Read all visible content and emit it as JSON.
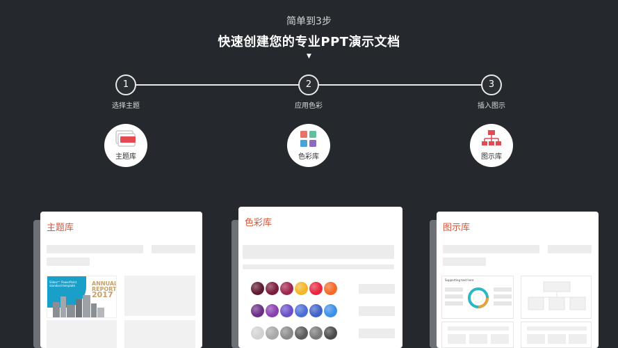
{
  "header": {
    "subtitle": "简单到3步",
    "title": "快速创建您的专业PPT演示文档",
    "arrow": "▼"
  },
  "steps": [
    {
      "number": "1",
      "label": "选择主题"
    },
    {
      "number": "2",
      "label": "应用色彩"
    },
    {
      "number": "3",
      "label": "插入图示"
    }
  ],
  "libraries": [
    {
      "label": "主题库",
      "icon": "slides-icon"
    },
    {
      "label": "色彩库",
      "icon": "color-palette-icon"
    },
    {
      "label": "图示库",
      "icon": "org-chart-icon"
    }
  ],
  "cards": {
    "theme": {
      "title": "主题库",
      "cover": {
        "line1": "Slidez™ PowerPoint",
        "line2": "standard template",
        "report": "ANNUAL REPORT",
        "year": "2017"
      }
    },
    "color": {
      "title": "色彩库"
    },
    "diagram": {
      "title": "图示库",
      "caption": "Supporting text here"
    }
  },
  "palette": {
    "rows": [
      [
        "#5e1a33",
        "#7a1c3d",
        "#a0254e",
        "#f3b62a",
        "#e8263f",
        "#f46a2a"
      ],
      [
        "#6a2e86",
        "#8a3fb0",
        "#6a4fc8",
        "#4a6ed6",
        "#3f62c6",
        "#3d8fe8"
      ],
      [
        "#d2d2d2",
        "#a8a8a8",
        "#8a8a8a",
        "#5c5c5c",
        "#7a7a7a",
        "#4a4a4a"
      ]
    ]
  },
  "colors": {
    "background": "#25282c",
    "accent": "#d4573a",
    "card": "#ffffff"
  }
}
